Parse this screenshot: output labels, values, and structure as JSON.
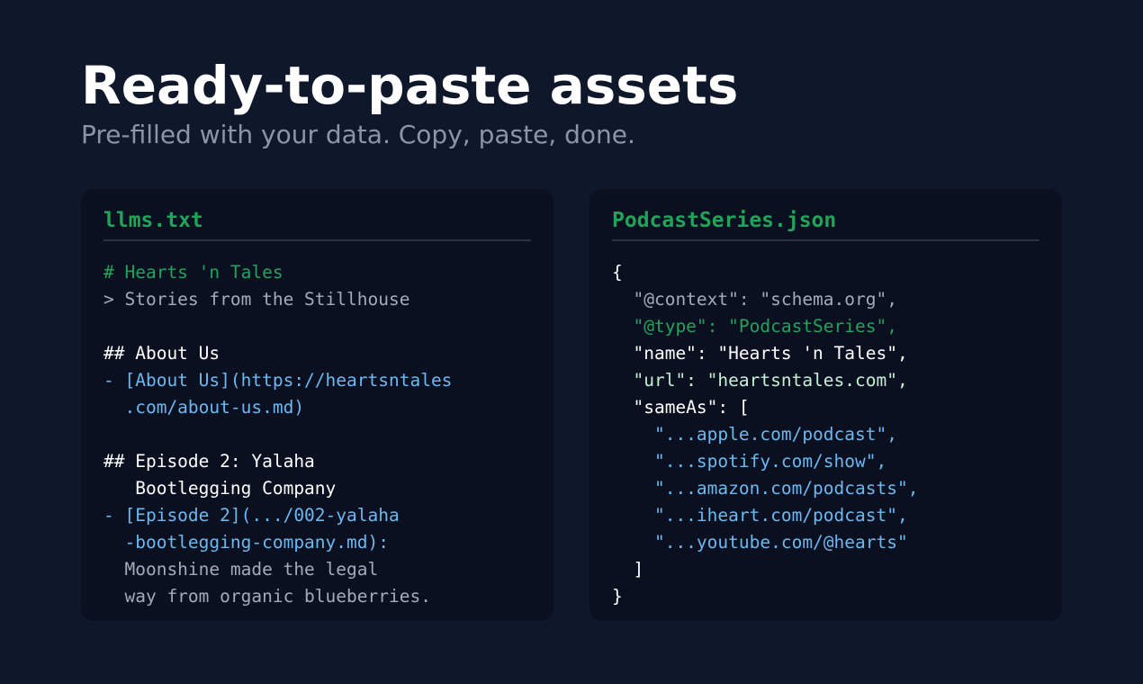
{
  "header": {
    "title": "Ready-to-paste assets",
    "subtitle": "Pre-filled with your data. Copy, paste, done."
  },
  "colors": {
    "background": "#0f172a",
    "card": "#0a1020",
    "accent_green": "#22a35a",
    "link_blue": "#6cb8f0",
    "muted_gray": "#a3abb8"
  },
  "llms_card": {
    "title": "llms.txt",
    "lines": [
      {
        "text": "# Hearts 'n Tales",
        "color": "green"
      },
      {
        "text": "> Stories from the Stillhouse",
        "color": "gray"
      },
      {
        "text": "",
        "color": "white"
      },
      {
        "text": "## About Us",
        "color": "white"
      },
      {
        "text": "- [About Us](https://heartsntales",
        "color": "blue"
      },
      {
        "text": "  .com/about-us.md)",
        "color": "blue"
      },
      {
        "text": "",
        "color": "white"
      },
      {
        "text": "## Episode 2: Yalaha",
        "color": "white"
      },
      {
        "text": "   Bootlegging Company",
        "color": "white"
      },
      {
        "text": "- [Episode 2](.../002-yalaha",
        "color": "blue"
      },
      {
        "text": "  -bootlegging-company.md):",
        "color": "blue"
      },
      {
        "text": "  Moonshine made the legal",
        "color": "gray"
      },
      {
        "text": "  way from organic blueberries.",
        "color": "gray"
      }
    ]
  },
  "json_card": {
    "title": "PodcastSeries.json",
    "lines": [
      {
        "text": "{",
        "color": "white"
      },
      {
        "text": "  \"@context\": \"schema.org\",",
        "color": "gray"
      },
      {
        "text": "  \"@type\": \"PodcastSeries\",",
        "color": "green"
      },
      {
        "text": "  \"name\": \"Hearts 'n Tales\",",
        "color": "white"
      },
      {
        "text": "  \"url\": \"heartsntales.com\",",
        "color": "mint"
      },
      {
        "text": "  \"sameAs\": [",
        "color": "white"
      },
      {
        "text": "    \"...apple.com/podcast\",",
        "color": "blue"
      },
      {
        "text": "    \"...spotify.com/show\",",
        "color": "blue"
      },
      {
        "text": "    \"...amazon.com/podcasts\",",
        "color": "blue"
      },
      {
        "text": "    \"...iheart.com/podcast\",",
        "color": "blue"
      },
      {
        "text": "    \"...youtube.com/@hearts\"",
        "color": "blue"
      },
      {
        "text": "  ]",
        "color": "white"
      },
      {
        "text": "}",
        "color": "white"
      }
    ]
  }
}
